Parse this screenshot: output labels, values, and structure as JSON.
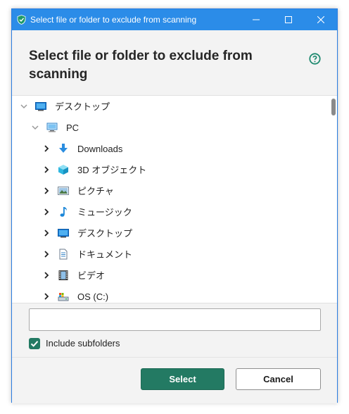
{
  "window": {
    "title": "Select file or folder to exclude from scanning",
    "heading": "Select file or folder to exclude from scanning"
  },
  "tree": {
    "nodes": [
      {
        "label": "デスクトップ",
        "icon": "desktop-icon",
        "state": "expanded"
      },
      {
        "label": "PC",
        "icon": "computer-icon",
        "state": "expanded"
      },
      {
        "label": "Downloads",
        "icon": "download-arrow-icon",
        "state": "collapsed"
      },
      {
        "label": "3D オブジェクト",
        "icon": "cube-3d-icon",
        "state": "collapsed"
      },
      {
        "label": "ピクチャ",
        "icon": "pictures-icon",
        "state": "collapsed"
      },
      {
        "label": "ミュージック",
        "icon": "music-note-icon",
        "state": "collapsed"
      },
      {
        "label": "デスクトップ",
        "icon": "desktop-icon",
        "state": "collapsed"
      },
      {
        "label": "ドキュメント",
        "icon": "document-icon",
        "state": "collapsed"
      },
      {
        "label": "ビデオ",
        "icon": "film-icon",
        "state": "collapsed"
      },
      {
        "label": "OS (C:)",
        "icon": "drive-icon",
        "state": "collapsed"
      }
    ]
  },
  "path_field": {
    "value": "",
    "placeholder": ""
  },
  "options": {
    "include_subfolders_label": "Include subfolders",
    "include_subfolders_checked": true
  },
  "buttons": {
    "select": "Select",
    "cancel": "Cancel"
  },
  "colors": {
    "titlebar": "#2b8ce8",
    "accent": "#237a63",
    "help": "#1f8a70"
  }
}
